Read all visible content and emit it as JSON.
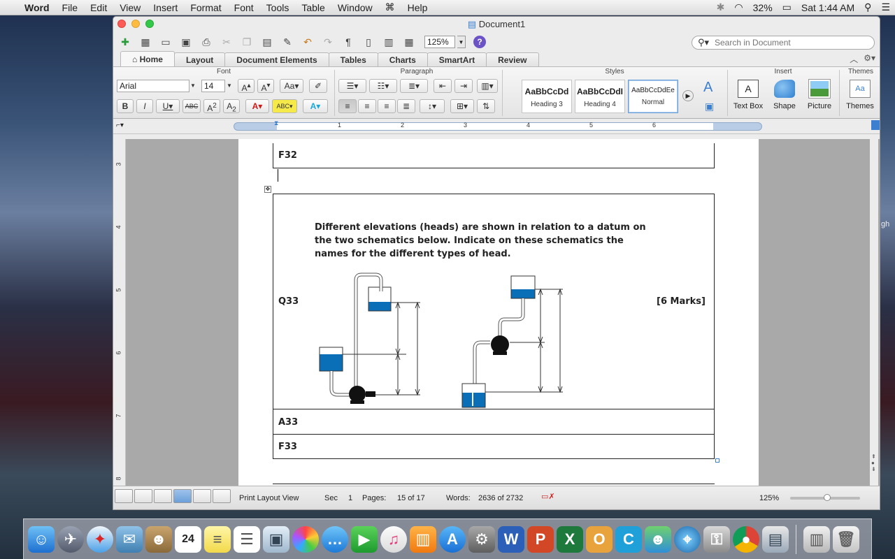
{
  "menubar": {
    "app_name": "Word",
    "items": [
      "File",
      "Edit",
      "View",
      "Insert",
      "Format",
      "Font",
      "Tools",
      "Table",
      "Window",
      "Help"
    ],
    "battery": "32%",
    "clock": "Sat 1:44 AM"
  },
  "window": {
    "title": "Document1",
    "zoom": "125%",
    "search_placeholder": "Search in Document"
  },
  "ribbon": {
    "tabs": [
      "Home",
      "Layout",
      "Document Elements",
      "Tables",
      "Charts",
      "SmartArt",
      "Review"
    ],
    "active_tab": "Home",
    "groups": {
      "font": "Font",
      "paragraph": "Paragraph",
      "styles": "Styles",
      "insert": "Insert",
      "themes": "Themes"
    },
    "font_name": "Arial",
    "font_size": "14",
    "styles": [
      {
        "sample": "AaBbCcDd",
        "name": "Heading 3"
      },
      {
        "sample": "AaBbCcDdI",
        "name": "Heading 4"
      },
      {
        "sample": "AaBbCcDdEe",
        "name": "Normal"
      }
    ],
    "insert_items": [
      "Text Box",
      "Shape",
      "Picture"
    ],
    "themes_label": "Themes"
  },
  "ruler": {
    "marks": [
      "1",
      "2",
      "3",
      "4",
      "5",
      "6"
    ],
    "vmarks": [
      "3",
      "4",
      "5",
      "6",
      "7",
      "8"
    ]
  },
  "document": {
    "f32": "F32",
    "q33_label": "Q33",
    "q33_text": "Different elevations (heads) are shown in relation to a datum on the two schematics below. Indicate on these schematics the names for the different types of head.",
    "q33_marks": "[6 Marks]",
    "a33": "A33",
    "f33": "F33"
  },
  "statusbar": {
    "view": "Print Layout View",
    "sec_label": "Sec",
    "sec": "1",
    "pages_label": "Pages:",
    "pages": "15 of 17",
    "words_label": "Words:",
    "words": "2636 of 2732",
    "zoom": "125%"
  },
  "colors": {
    "water": "#0b6fb8",
    "accent": "#3c7fd1"
  }
}
